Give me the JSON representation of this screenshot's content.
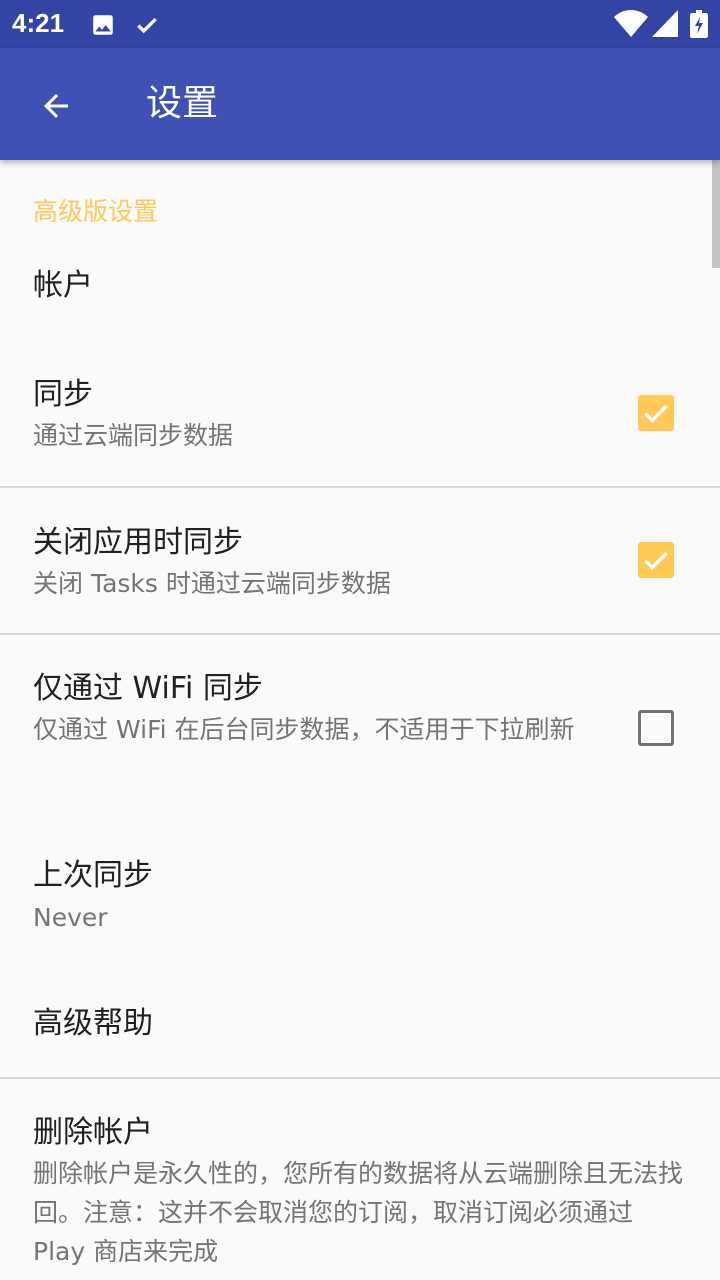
{
  "status_bar": {
    "time": "4:21",
    "left_icons": [
      "image-icon",
      "check-icon"
    ],
    "right_icons": [
      "wifi-icon",
      "signal-icon",
      "battery-icon"
    ]
  },
  "app_bar": {
    "back_icon": "arrow-back-icon",
    "title": "设置"
  },
  "category": {
    "title": "高级版设置"
  },
  "preferences": {
    "account": {
      "title": "帐户"
    },
    "sync": {
      "title": "同步",
      "summary": "通过云端同步数据",
      "checked": true
    },
    "sync_on_close": {
      "title": "关闭应用时同步",
      "summary": "关闭 Tasks 时通过云端同步数据",
      "checked": true
    },
    "wifi_only": {
      "title": "仅通过 WiFi 同步",
      "summary": "仅通过 WiFi 在后台同步数据，不适用于下拉刷新",
      "checked": false
    },
    "last_sync": {
      "title": "上次同步",
      "summary": "Never"
    },
    "help": {
      "title": "高级帮助"
    },
    "delete_account": {
      "title": "删除帐户",
      "summary": "删除帐户是永久性的，您所有的数据将从云端删除且无法找回。注意：这并不会取消您的订阅，取消订阅必须通过 Play 商店来完成"
    }
  },
  "colors": {
    "app_bar": "#3f51b5",
    "status_bar": "#3344a4",
    "accent": "#ffc857",
    "background": "#fafafa"
  }
}
